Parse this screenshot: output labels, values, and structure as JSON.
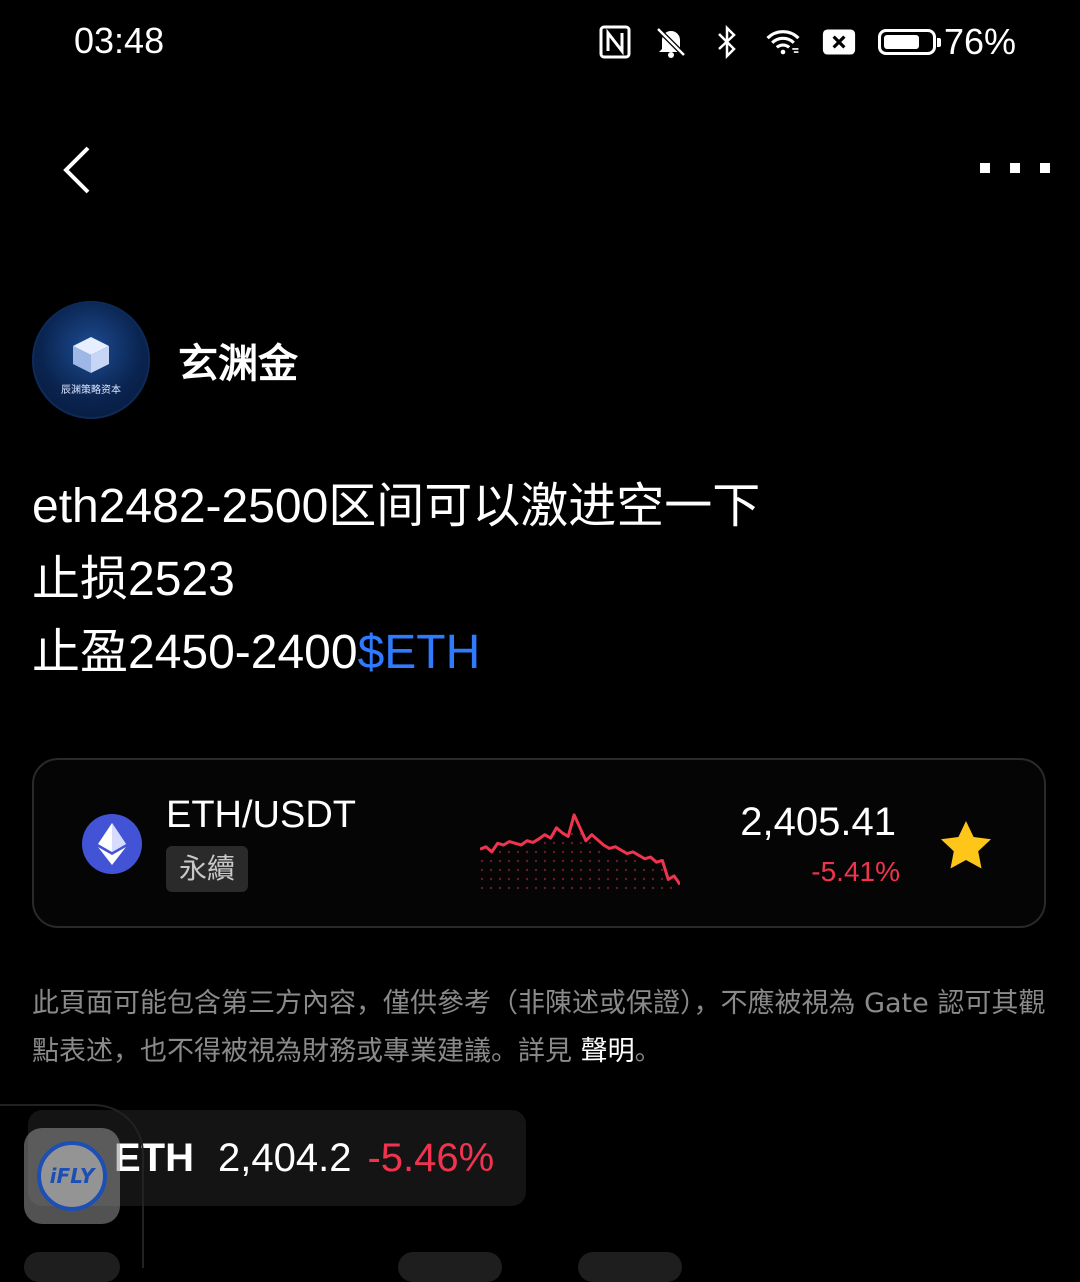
{
  "status_bar": {
    "time": "03:48",
    "battery_percent": "76%",
    "battery_level": 0.76,
    "icons": [
      "nfc-icon",
      "mute-bell-icon",
      "bluetooth-icon",
      "wifi-icon",
      "close-box-icon",
      "battery-icon"
    ]
  },
  "nav": {
    "back_icon": "chevron-left-icon",
    "more_icon": "more-dots-icon"
  },
  "author": {
    "name": "玄渊金",
    "avatar_text": "辰渊策略资本"
  },
  "post": {
    "line1": "eth2482-2500区间可以激进空一下",
    "line2": "止损2523",
    "line3_text": "止盈2450-2400",
    "line3_tag": "$ETH",
    "tag_color": "#2f7bff"
  },
  "market_card": {
    "pair": "ETH/USDT",
    "type_badge": "永續",
    "price": "2,405.41",
    "change": "-5.41%",
    "change_color": "#f0344f",
    "favorited": true,
    "sparkline": [
      0.45,
      0.48,
      0.42,
      0.52,
      0.5,
      0.54,
      0.52,
      0.5,
      0.55,
      0.53,
      0.57,
      0.62,
      0.58,
      0.7,
      0.64,
      0.6,
      0.85,
      0.7,
      0.55,
      0.62,
      0.56,
      0.5,
      0.46,
      0.48,
      0.44,
      0.4,
      0.42,
      0.38,
      0.34,
      0.36,
      0.3,
      0.32,
      0.1,
      0.14,
      0.04
    ]
  },
  "disclaimer": {
    "text": "此頁面可能包含第三方內容，僅供參考（非陳述或保證），不應被視為 Gate 認可其觀點表述，也不得被視為財務或專業建議。詳見 ",
    "link": "聲明",
    "end": "。"
  },
  "ticker": {
    "symbol": "ETH",
    "price": "2,404.2",
    "change": "-5.46%"
  },
  "floating_widget": {
    "label": "iFLY"
  }
}
